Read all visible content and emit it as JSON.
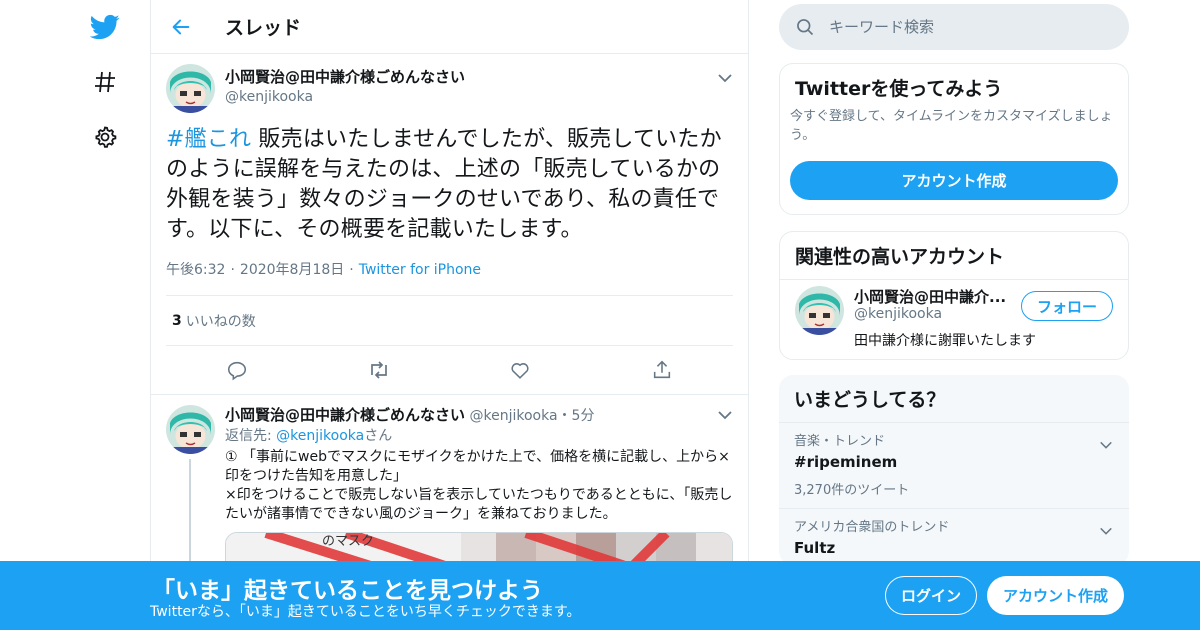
{
  "colors": {
    "accent": "#1da1f2",
    "link": "#1b95e0",
    "muted": "#657786",
    "border": "#e6ecf0"
  },
  "nav": {
    "icons": [
      "twitter-logo-icon",
      "hashtag-icon",
      "gear-icon"
    ]
  },
  "header": {
    "title": "スレッド",
    "back_icon": "arrow-left-icon"
  },
  "focus_tweet": {
    "display_name": "小岡賢治@田中謙介様ごめんなさい",
    "handle": "@kenjikooka",
    "hashtag": "#艦これ",
    "text": " 販売はいたしませんでしたが、販売していたかのように誤解を与えたのは、上述の「販売しているかの外観を装う」数々のジョークのせいであり、私の責任です。以下に、その概要を記載いたします。",
    "time": "午後6:32",
    "date": "2020年8月18日",
    "source": "Twitter for iPhone",
    "like_count": "3",
    "like_label": "いいねの数",
    "actions": [
      "reply-icon",
      "retweet-icon",
      "like-icon",
      "share-icon"
    ]
  },
  "reply_tweet": {
    "display_name": "小岡賢治@田中謙介様ごめんなさい",
    "handle": "@kenjikooka",
    "dot": "・",
    "time": "5分",
    "reply_to_prefix": "返信先: ",
    "reply_to_handle": "@kenjikooka",
    "reply_to_suffix": "さん",
    "text": "① 「事前にwebでマスクにモザイクをかけた上で、価格を横に記載し、上から×印をつけた告知を用意した」\n×印をつけることで販売しない旨を表示していたつもりであるとともに、「販売したいが諸事情でできない風のジョーク」を兼ねておりました。",
    "media_caption": "のマスク"
  },
  "search": {
    "placeholder": "キーワード検索"
  },
  "try_card": {
    "title": "Twitterを使ってみよう",
    "description": "今すぐ登録して、タイムラインをカスタマイズしましょう。",
    "button": "アカウント作成"
  },
  "related_card": {
    "title": "関連性の高いアカウント",
    "name": "小岡賢治@田中謙介...",
    "handle": "@kenjikooka",
    "bio": "田中謙介様に謝罪いたします",
    "follow_button": "フォロー"
  },
  "trends_card": {
    "title": "いまどうしてる？",
    "items": [
      {
        "context": "音楽・トレンド",
        "name": "#ripeminem",
        "count": "3,270件のツイート"
      },
      {
        "context": "アメリカ合衆国のトレンド",
        "name": "Fultz",
        "count": ""
      }
    ]
  },
  "banner": {
    "title": "「いま」起きていることを見つけよう",
    "subtitle": "Twitterなら、「いま」起きていることをいち早くチェックできます。",
    "login": "ログイン",
    "signup": "アカウント作成"
  }
}
